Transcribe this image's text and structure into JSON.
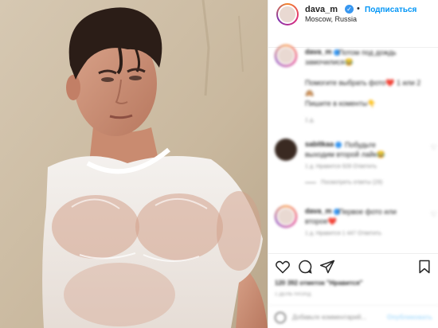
{
  "header": {
    "username": "dava_m",
    "follow_label": "Подписаться",
    "location": "Moscow, Russia",
    "separator": "•"
  },
  "comments": [
    {
      "username": "dava_m",
      "lines": [
        "Потом под дождь",
        "замочилися😂"
      ],
      "extra": [
        "Помогите выбрать фото❤️ 1 или 2",
        "🙈",
        "Пишите в коменты👇"
      ],
      "meta": "1 д."
    },
    {
      "username": "sabitkaa",
      "lines": [
        "Побудьте",
        "выходим второй лайк😂"
      ],
      "meta": "1 д.   Нравится 928   Ответить",
      "replies": "Посмотреть ответы (29)"
    },
    {
      "username": "dava_m",
      "lines": [
        "Первое фото или",
        "второе❤️"
      ],
      "meta": "1 д.   Нравится 1 447   Ответить"
    }
  ],
  "actions": {
    "likes": "120 392 отметок \"Нравится\"",
    "date": "1 ДЕНЬ НАЗАД",
    "add_placeholder": "Добавьте комментарий...",
    "publish_label": "Опубликовать"
  },
  "icons": {
    "verified": "verified-icon",
    "heart": "heart-icon",
    "comment": "comment-icon",
    "share": "share-icon",
    "bookmark": "bookmark-icon",
    "emoji": "emoji-icon"
  },
  "colors": {
    "link_blue": "#0095f6",
    "verified_blue": "#3897f0",
    "border": "#efefef",
    "muted": "#8e8e8e"
  }
}
